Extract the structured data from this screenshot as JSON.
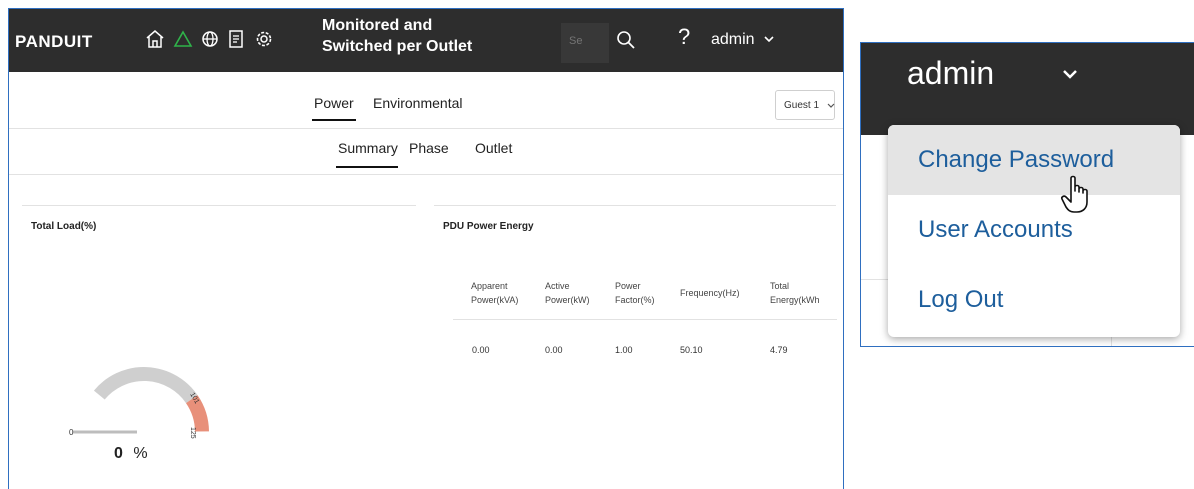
{
  "header": {
    "logo": "PANDUIT",
    "device_title_line1": "Monitored and",
    "device_title_line2": "Switched per Outlet",
    "search_placeholder": "Se",
    "help": "?",
    "user": "admin",
    "nav_icons": [
      "home-icon",
      "alert-icon",
      "globe-icon",
      "document-icon",
      "settings-icon",
      "search-icon",
      "help-icon",
      "chevron-down-icon"
    ],
    "alert_color": "#2fb34a"
  },
  "tabs": {
    "primary": [
      "Power",
      "Environmental"
    ],
    "secondary": [
      "Summary",
      "Phase",
      "Outlet"
    ],
    "guest_select": "Guest 1"
  },
  "total_load": {
    "title": "Total Load(%)",
    "value": "0",
    "unit": "%",
    "gauge_min": "0",
    "gauge_warn": "101",
    "gauge_max": "125",
    "gauge_fraction": 0,
    "gauge_color": "#cfcfcf",
    "gauge_warn_color": "#e8907a"
  },
  "pdu_energy": {
    "title": "PDU Power Energy",
    "headers": [
      [
        "Apparent",
        "Power(kVA)"
      ],
      [
        "Active",
        "Power(kW)"
      ],
      [
        "Power",
        "Factor(%)"
      ],
      [
        "Frequency(Hz)"
      ],
      [
        "Total",
        "Energy(kWh"
      ]
    ],
    "values": [
      "0.00",
      "0.00",
      "1.00",
      "50.10",
      "4.79"
    ]
  },
  "user_menu": {
    "user": "admin",
    "items": [
      "Change Password",
      "User Accounts",
      "Log Out"
    ],
    "hover_index": 0,
    "link_color": "#1d5e9c"
  }
}
